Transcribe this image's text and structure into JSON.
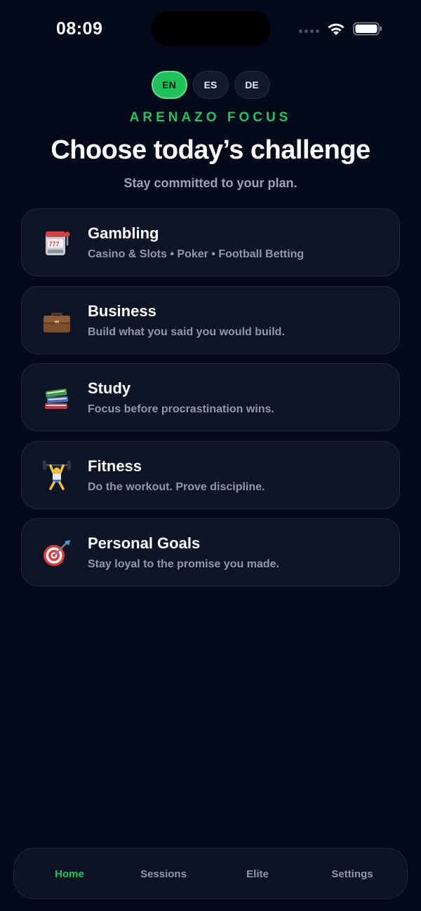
{
  "status_bar": {
    "time": "08:09"
  },
  "languages": [
    {
      "code": "EN",
      "active": true
    },
    {
      "code": "ES",
      "active": false
    },
    {
      "code": "DE",
      "active": false
    }
  ],
  "brand": "ARENAZO FOCUS",
  "title": "Choose today’s challenge",
  "subtitle": "Stay committed to your plan.",
  "challenges": [
    {
      "icon": "slot-machine-icon",
      "title": "Gambling",
      "description": "Casino & Slots • Poker • Football Betting"
    },
    {
      "icon": "briefcase-icon",
      "title": "Business",
      "description": "Build what you said you would build."
    },
    {
      "icon": "books-icon",
      "title": "Study",
      "description": "Focus before procrastination wins."
    },
    {
      "icon": "weightlifter-icon",
      "title": "Fitness",
      "description": "Do the workout. Prove discipline."
    },
    {
      "icon": "target-dart-icon",
      "title": "Personal Goals",
      "description": "Stay loyal to the promise you made."
    }
  ],
  "tabs": [
    {
      "label": "Home",
      "active": true
    },
    {
      "label": "Sessions",
      "active": false
    },
    {
      "label": "Elite",
      "active": false
    },
    {
      "label": "Settings",
      "active": false
    }
  ],
  "colors": {
    "background": "#040a1a",
    "card": "#0d1526",
    "accent": "#22c55e",
    "muted_text": "#8f99ad"
  }
}
